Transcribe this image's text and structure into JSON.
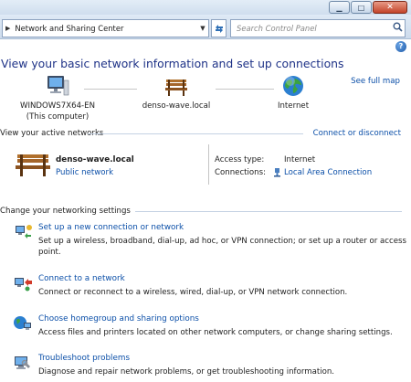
{
  "window": {
    "minimize_glyph": "▁",
    "maximize_glyph": "□",
    "close_glyph": "✕"
  },
  "nav": {
    "breadcrumb": "Network and Sharing Center",
    "search_placeholder": "Search Control Panel"
  },
  "header": {
    "title": "View your basic network information and set up connections",
    "see_full_map": "See full map"
  },
  "map": {
    "nodes": [
      {
        "line1": "WINDOWS7X64-EN",
        "line2": "(This computer)",
        "icon": "computer-icon"
      },
      {
        "line1": "denso-wave.local",
        "line2": "",
        "icon": "bench-icon"
      },
      {
        "line1": "Internet",
        "line2": "",
        "icon": "globe-icon"
      }
    ]
  },
  "active": {
    "heading": "View your active networks",
    "connect_disconnect": "Connect or disconnect",
    "network_name": "denso-wave.local",
    "network_type": "Public network",
    "access_type_label": "Access type:",
    "access_type_value": "Internet",
    "connections_label": "Connections:",
    "connections_value": "Local Area Connection"
  },
  "settings": {
    "heading": "Change your networking settings",
    "tasks": [
      {
        "link": "Set up a new connection or network",
        "desc": "Set up a wireless, broadband, dial-up, ad hoc, or VPN connection; or set up a router or access point.",
        "icon": "new-connection-icon"
      },
      {
        "link": "Connect to a network",
        "desc": "Connect or reconnect to a wireless, wired, dial-up, or VPN network connection.",
        "icon": "connect-network-icon"
      },
      {
        "link": "Choose homegroup and sharing options",
        "desc": "Access files and printers located on other network computers, or change sharing settings.",
        "icon": "homegroup-icon"
      },
      {
        "link": "Troubleshoot problems",
        "desc": "Diagnose and repair network problems, or get troubleshooting information.",
        "icon": "troubleshoot-icon"
      }
    ]
  },
  "colors": {
    "link": "#0b4fa8",
    "title": "#1e3287",
    "chrome": "#d6e3f1"
  }
}
